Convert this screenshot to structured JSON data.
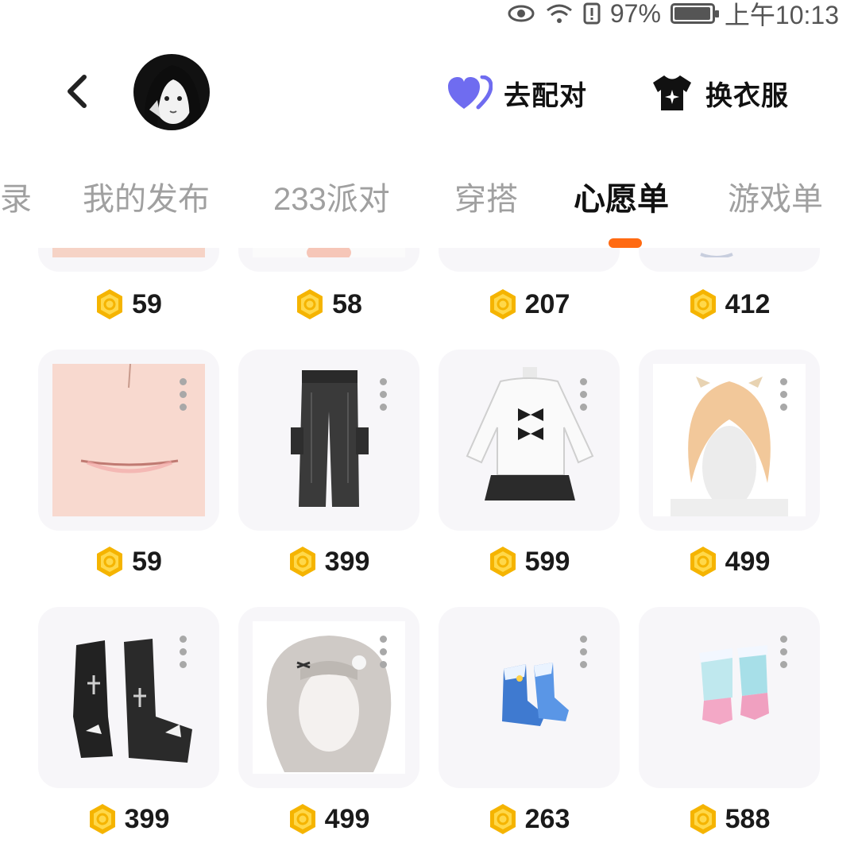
{
  "status": {
    "battery": "97%",
    "time": "上午10:13",
    "battery_level": 0.97
  },
  "header": {
    "back_icon": "chevron-left-icon",
    "pair_label": "去配对",
    "pair_icon": "heart-icon",
    "pair_color": "#6f6cf0",
    "outfit_label": "换衣服",
    "outfit_icon": "shirt-icon"
  },
  "tabs": [
    {
      "label": "录"
    },
    {
      "label": "我的发布"
    },
    {
      "label": "233派对"
    },
    {
      "label": "穿搭"
    },
    {
      "label": "心愿单",
      "active": true
    },
    {
      "label": "游戏单"
    }
  ],
  "accent": "#ff6a12",
  "items": [
    {
      "price": "59"
    },
    {
      "price": "58"
    },
    {
      "price": "207"
    },
    {
      "price": "412"
    },
    {
      "price": "59"
    },
    {
      "price": "399"
    },
    {
      "price": "599"
    },
    {
      "price": "499"
    },
    {
      "price": "399"
    },
    {
      "price": "499"
    },
    {
      "price": "263"
    },
    {
      "price": "588"
    }
  ]
}
